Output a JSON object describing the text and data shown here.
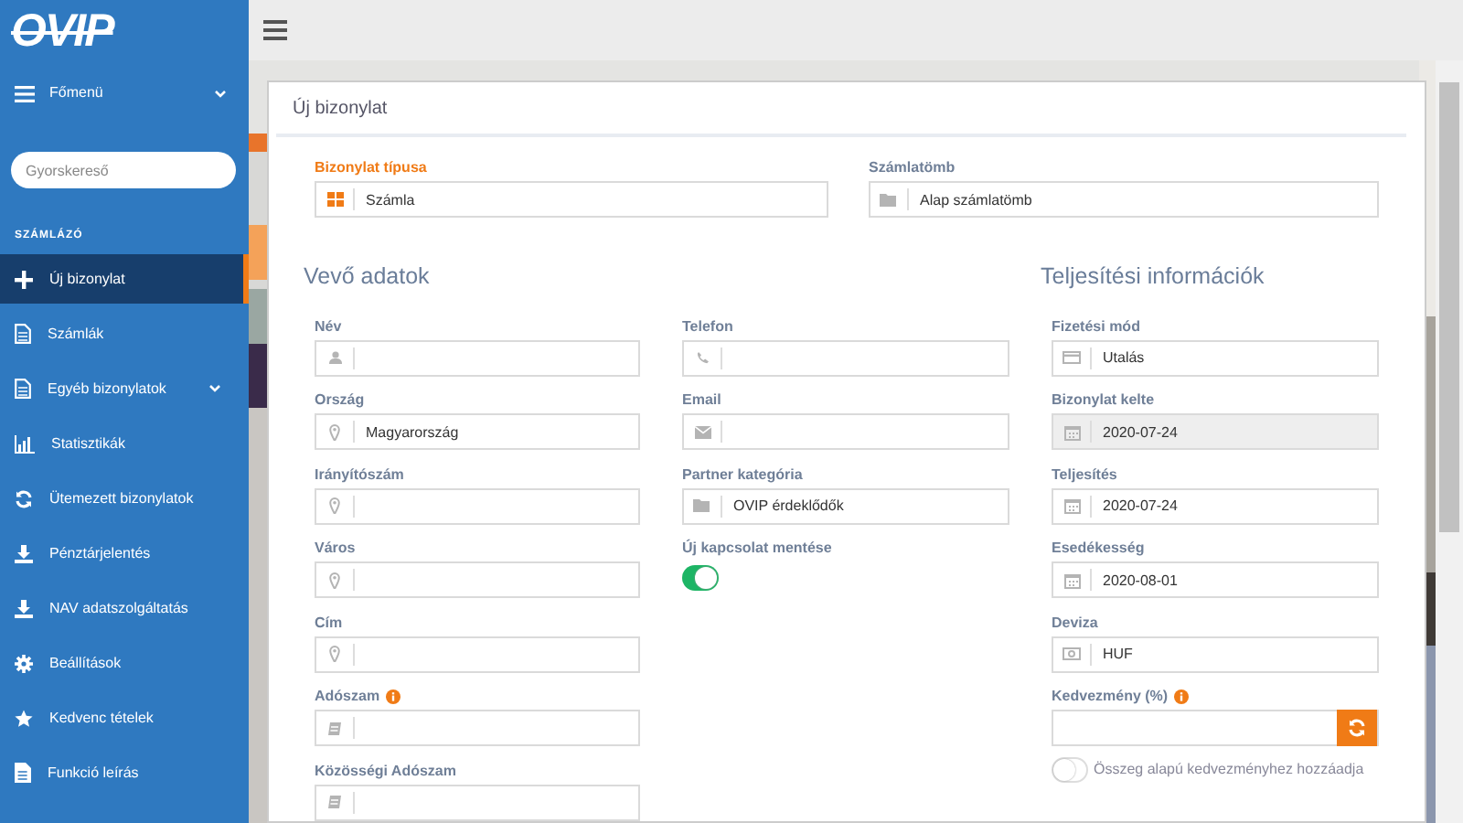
{
  "sidebar": {
    "logo": "OVIP",
    "menu_toggle": {
      "label": "Főmenü",
      "expanded": false
    },
    "search": {
      "placeholder": "Gyorskereső"
    },
    "section": "SZÁMLÁZÓ",
    "items": [
      {
        "label": "Új bizonylat",
        "selected": true
      },
      {
        "label": "Számlák",
        "selected": false
      },
      {
        "label": "Egyéb bizonylatok",
        "selected": false,
        "expandable": true
      },
      {
        "label": "Statisztikák",
        "selected": false
      },
      {
        "label": "Ütemezett bizonylatok",
        "selected": false
      },
      {
        "label": "Pénztárjelentés",
        "selected": false
      },
      {
        "label": "NAV adatszolgáltatás",
        "selected": false
      },
      {
        "label": "Beállítások",
        "selected": false
      },
      {
        "label": "Kedvenc tételek",
        "selected": false
      },
      {
        "label": "Funkció leírás",
        "selected": false
      }
    ]
  },
  "form": {
    "title": "Új bizonylat",
    "top_fields": [
      {
        "label": "Bizonylat típusa",
        "value": "Számla",
        "highlighted": true
      },
      {
        "label": "Számlatömb",
        "value": "Alap számlatömb",
        "highlighted": false
      }
    ],
    "customer_heading": "Vevő adatok",
    "fulfillment_heading": "Teljesítési információk",
    "customer_fields": [
      {
        "label": "Név"
      },
      {
        "label": "Ország",
        "value": "Magyarország"
      },
      {
        "label": "Irányítószám"
      },
      {
        "label": "Város"
      },
      {
        "label": "Cím"
      },
      {
        "label": "Adószam",
        "info": true
      },
      {
        "label": "Közösségi Adószam"
      }
    ],
    "contact_fields": [
      {
        "kind": "input",
        "label": "Telefon"
      },
      {
        "kind": "input",
        "label": "Email"
      },
      {
        "kind": "input",
        "label": "Partner kategória",
        "value": "OVIP érdeklődők"
      },
      {
        "kind": "toggle",
        "label": "Új kapcsolat mentése",
        "on": true
      }
    ],
    "fulfillment_fields": [
      {
        "kind": "input",
        "label": "Fizetési mód",
        "value": "Utalás",
        "disabled": false
      },
      {
        "kind": "input",
        "label": "Bizonylat kelte",
        "value": "2020-07-24",
        "disabled": true
      },
      {
        "kind": "input",
        "label": "Teljesítés",
        "value": "2020-07-24",
        "disabled": false
      },
      {
        "kind": "input",
        "label": "Esedékesség",
        "value": "2020-08-01",
        "disabled": false
      },
      {
        "kind": "input",
        "label": "Deviza",
        "value": "HUF",
        "disabled": false
      },
      {
        "kind": "button-input",
        "label": "Kedvezmény (%)",
        "info": true,
        "disabled": false
      }
    ],
    "discount_toggle": {
      "label": "Összeg alapú kedvezményhez hozzáadja",
      "on": false
    }
  }
}
